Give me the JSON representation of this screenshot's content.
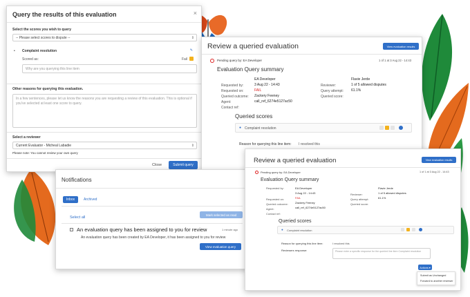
{
  "modal": {
    "title": "Query the results of this evaluation",
    "close_glyph": "×",
    "select_scores_label": "Select the scores you wish to query",
    "select_placeholder": "-- Please select scores to dispute --",
    "item_title": "Complaint resolution",
    "scored_as_label": "Scored as:",
    "scored_value": "Fail",
    "item_placeholder": "Why are you querying this line item",
    "other_reasons_label": "Other reasons for querying this evaluation.",
    "other_reasons_placeholder": "In a few sentences, please let us know the reasons you are requesting a review of this evaluation. This is optional if you've selected at least one score to query.",
    "reviewer_label": "Select a reviewer",
    "reviewer_value": "Current Evaluator - Micheal Labadie",
    "note": "Please note: You cannot review your own query",
    "close_button": "Close",
    "submit_button": "Submit query"
  },
  "review1": {
    "title": "Review a queried evaluation",
    "view_button": "View evaluation results",
    "pending_text": "Pending query by: EA Developer",
    "pager": "1 of 1 at 3 Aug 22 - 14:43",
    "summary_title": "Evaluation Query summary",
    "left": [
      {
        "label": "Requested by:",
        "value": "EA Developer"
      },
      {
        "label": "Requested on:",
        "value": "3 Aug 22 - 14:43"
      },
      {
        "label": "Queried outcome:",
        "value": "FAIL"
      },
      {
        "label": "Agent:",
        "value": "Zackery Feeney"
      },
      {
        "label": "Contact ref:",
        "value": "call_ref_6274e5127ac50"
      }
    ],
    "right": [
      {
        "label": "Reviewer:",
        "value": "Flavie Jerde"
      },
      {
        "label": "Query attempt:",
        "value": "1 of 5 allowed disputes"
      },
      {
        "label": "Queried score:",
        "value": "61.1%"
      }
    ],
    "queried_scores_title": "Queried scores",
    "score_item": "Complaint resolution",
    "reason_label": "Reason for querying this line item:",
    "reason_value": "I resolved this"
  },
  "notifications": {
    "title": "Notifications",
    "tab_inbox": "Inbox",
    "tab_archived": "Archived",
    "mark_button": "Mark selected as read",
    "select_all": "Select all",
    "item_title": "An evaluation query has been assigned to you for review",
    "item_time": "1 minute ago",
    "item_body": "An evaluation query has been created by EA Developer, it has been assigned to you for review",
    "view_button": "View evaluation query"
  },
  "review2": {
    "title": "Review a queried evaluation",
    "view_button": "View evaluation results",
    "pending_text": "Pending query by: EA Developer",
    "pager": "1 of 1 at 3 Aug 22 - 14:43",
    "summary_title": "Evaluation Query summary",
    "left": [
      {
        "label": "Requested by:",
        "value": "EA Developer"
      },
      {
        "label": "Requested on:",
        "value": "3 Aug 22 - 14:43"
      },
      {
        "label": "Queried outcome:",
        "value": "FAIL"
      },
      {
        "label": "Agent:",
        "value": "Zackery Feeney"
      },
      {
        "label": "Contact ref:",
        "value": "call_ref_6274e5127ac50"
      }
    ],
    "right": [
      {
        "label": "Reviewer:",
        "value": "Flavie Jerde"
      },
      {
        "label": "Query attempt:",
        "value": "1 of 5 allowed disputes"
      },
      {
        "label": "Queried score:",
        "value": "61.1%"
      }
    ],
    "queried_scores_title": "Queried scores",
    "score_item": "Complaint resolution",
    "reason_label": "Reason for querying this line item:",
    "reason_value": "I resolved this",
    "response_label": "Reviewers response:",
    "response_placeholder": "Please enter a specific response for the queried line item Complaint resolution",
    "actions_button": "Actions ▾",
    "menu": [
      "Submit as Unchanged",
      "Forward to another reviewer"
    ]
  },
  "colors": {
    "accent": "#2f6fc8",
    "fail": "#d22222",
    "pending": "#d22222",
    "leaf_dark": "#1f8a3a",
    "leaf_orange": "#e46a1e"
  }
}
